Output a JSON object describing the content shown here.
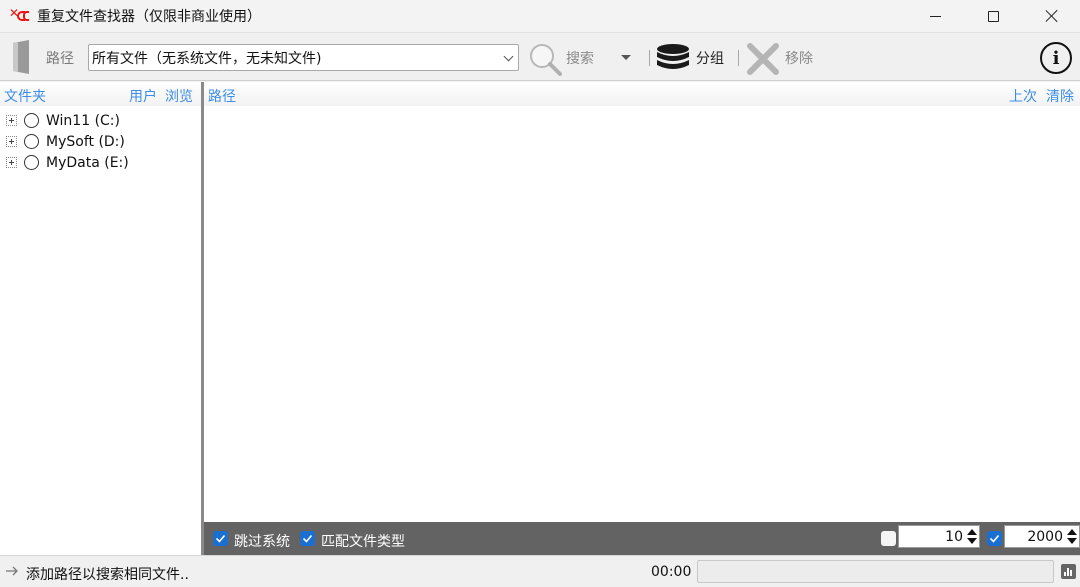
{
  "window": {
    "title": "重复文件查找器（仅限非商业使用）"
  },
  "toolbar": {
    "path_label": "路径",
    "path_select_value": "所有文件（无系统文件，无未知文件)",
    "search_label": "搜索",
    "group_label": "分组",
    "remove_label": "移除"
  },
  "left_panel": {
    "header": {
      "folder": "文件夹",
      "user": "用户",
      "browse": "浏览"
    },
    "drives": [
      {
        "label": "Win11 (C:)"
      },
      {
        "label": "MySoft (D:)"
      },
      {
        "label": "MyData (E:)"
      }
    ]
  },
  "right_panel": {
    "header": {
      "path": "路径",
      "last": "上次",
      "clear": "清除"
    }
  },
  "options": {
    "skip_system": {
      "label": "跳过系统",
      "checked": true
    },
    "match_type": {
      "label": "匹配文件类型",
      "checked": true
    },
    "min_size": {
      "checked": false,
      "value": "10"
    },
    "max_size": {
      "checked": true,
      "value": "2000"
    }
  },
  "status": {
    "text": "添加路径以搜索相同文件..",
    "time": "00:00",
    "progress": 0
  },
  "colors": {
    "link_blue": "#3c8de8",
    "accent_red": "#e11",
    "options_bar": "#636363",
    "checkbox_blue": "#1a6fd0"
  }
}
